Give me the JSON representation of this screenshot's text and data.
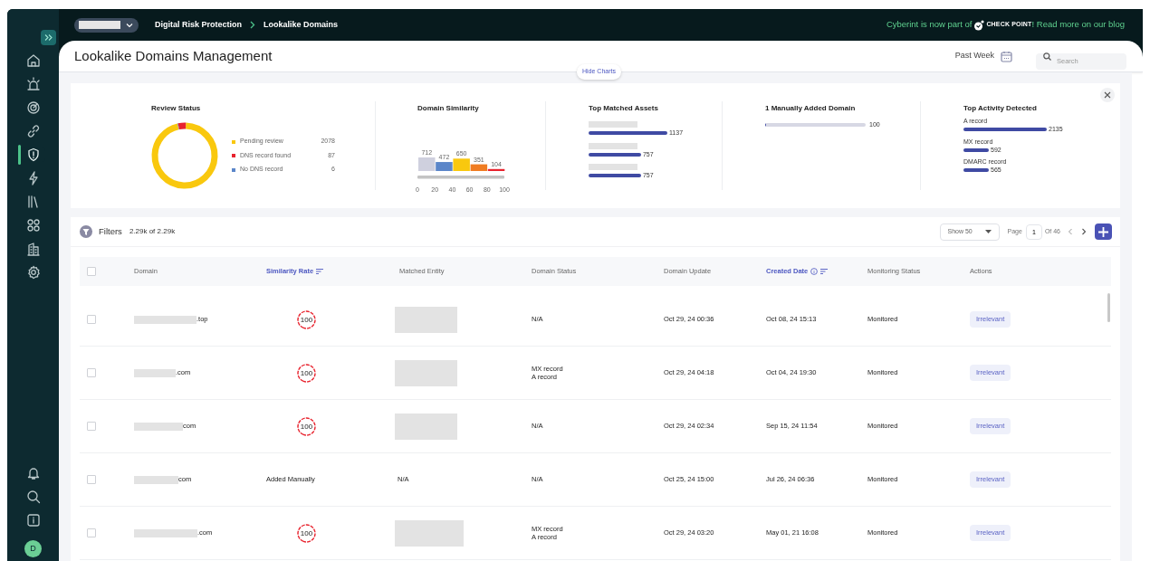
{
  "topbar": {
    "breadcrumb": [
      "Digital Risk Protection",
      "Lookalike Domains"
    ],
    "announcement": {
      "before": "Cyberint is now part of",
      "logo_text": "CHECK POINT",
      "after": "! Read more on our blog"
    }
  },
  "sidebar": {
    "nav_items": [
      {
        "selected": false
      },
      {
        "selected": false
      },
      {
        "selected": false
      },
      {
        "selected": false
      },
      {
        "selected": true
      },
      {
        "selected": false
      },
      {
        "selected": false
      },
      {
        "selected": false
      },
      {
        "selected": false
      },
      {
        "selected": false
      }
    ],
    "avatar": "D"
  },
  "page": {
    "title": "Lookalike Domains Management",
    "period": "Past Week",
    "search_placeholder": "Search",
    "hide_charts": "Hide Charts"
  },
  "charts": {
    "review_status": {
      "title": "Review Status",
      "legend": [
        {
          "label": "Pending review",
          "count": "2078",
          "color": "#f9c80e"
        },
        {
          "label": "DNS record found",
          "count": "87",
          "color": "#e8232e"
        },
        {
          "label": "No DNS record",
          "count": "6",
          "color": "#5b86c9"
        }
      ]
    },
    "domain_similarity": {
      "title": "Domain Similarity",
      "axis_labels": [
        "0",
        "20",
        "40",
        "60",
        "80",
        "100"
      ],
      "chart_data": {
        "type": "bar",
        "values": [
          712,
          472,
          650,
          351,
          104
        ],
        "colors": [
          "#cfd0de",
          "#5b86c9",
          "#f9c80e",
          "#f07c22",
          "#e8232e"
        ],
        "data_labels": true
      }
    },
    "top_matched_assets": {
      "title": "Top Matched Assets",
      "items": [
        {
          "value": "1137"
        },
        {
          "value": "757"
        },
        {
          "value": "757"
        }
      ]
    },
    "manually_added": {
      "title": "1 Manually Added Domain",
      "level": 0.01,
      "value": "100"
    },
    "top_activity": {
      "title": "Top Activity Detected",
      "items": [
        {
          "label": "A record",
          "value": "2135"
        },
        {
          "label": "MX record",
          "value": "592"
        },
        {
          "label": "DMARC record",
          "value": "565"
        }
      ]
    }
  },
  "table": {
    "filters_label": "Filters",
    "count": "2.29k of 2.29k",
    "page_size": "Show 50",
    "page_label": "Page",
    "page": "1",
    "page_total": "Of 46",
    "select_all_checked": false,
    "columns": [
      {
        "label": "Domain",
        "sorted": false,
        "info": false
      },
      {
        "label": "Similarity Rate",
        "sorted": true,
        "info": false
      },
      {
        "label": "Matched Entity",
        "sorted": false,
        "info": false
      },
      {
        "label": "Domain Status",
        "sorted": false,
        "info": false
      },
      {
        "label": "Domain Update",
        "sorted": false,
        "info": false
      },
      {
        "label": "Created Date",
        "sorted": true,
        "info": true
      },
      {
        "label": "Monitoring Status",
        "sorted": false,
        "info": false
      },
      {
        "label": "Actions",
        "sorted": false,
        "info": false
      }
    ],
    "rows": [
      {
        "checked": false,
        "domain_suffix": ".top",
        "similarity": {
          "kind": "gauge",
          "text": "100"
        },
        "matched": {
          "kind": "redacted"
        },
        "status": [
          "N/A"
        ],
        "updated": "Oct 29, 24 00:36",
        "created": "Oct 08, 24 15:13",
        "monitoring": "Monitored",
        "action": "Irrelevant"
      },
      {
        "checked": false,
        "domain_suffix": ".com",
        "similarity": {
          "kind": "gauge",
          "text": "100"
        },
        "matched": {
          "kind": "redacted"
        },
        "status": [
          "MX record",
          "A record"
        ],
        "updated": "Oct 29, 24 04:18",
        "created": "Oct 04, 24 19:30",
        "monitoring": "Monitored",
        "action": "Irrelevant"
      },
      {
        "checked": false,
        "domain_suffix": "com",
        "similarity": {
          "kind": "gauge",
          "text": "100"
        },
        "matched": {
          "kind": "redacted"
        },
        "status": [
          "N/A"
        ],
        "updated": "Oct 29, 24 02:34",
        "created": "Sep 15, 24 11:54",
        "monitoring": "Monitored",
        "action": "Irrelevant"
      },
      {
        "checked": false,
        "domain_suffix": "com",
        "similarity": {
          "kind": "text",
          "text": "Added Manually"
        },
        "matched": {
          "kind": "text",
          "text": "N/A"
        },
        "status": [
          "N/A"
        ],
        "updated": "Oct 25, 24 15:00",
        "created": "Jul 26, 24 06:36",
        "monitoring": "Monitored",
        "action": "Irrelevant"
      },
      {
        "checked": false,
        "domain_suffix": ".com",
        "similarity": {
          "kind": "gauge",
          "text": "100"
        },
        "matched": {
          "kind": "redacted"
        },
        "status": [
          "MX record",
          "A record"
        ],
        "updated": "Oct 29, 24 03:20",
        "created": "May 01, 21 16:08",
        "monitoring": "Monitored",
        "action": "Irrelevant"
      }
    ]
  }
}
